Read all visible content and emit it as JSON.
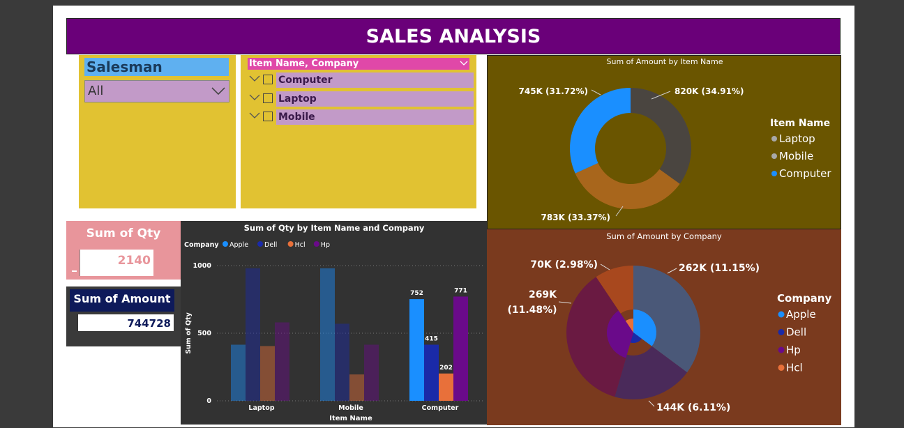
{
  "header": {
    "title": "SALES ANALYSIS"
  },
  "salesman_slicer": {
    "label": "Salesman",
    "value": "All"
  },
  "item_slicer": {
    "header": "Item Name, Company",
    "items": [
      {
        "label": "Computer"
      },
      {
        "label": "Laptop"
      },
      {
        "label": "Mobile"
      }
    ]
  },
  "cards": {
    "qty": {
      "title": "Sum of Qty",
      "value": "2140"
    },
    "amount": {
      "title": "Sum of Amount",
      "value": "744728"
    }
  },
  "colors": {
    "title_bg": "#6a0079",
    "slicer_bg": "#e1c232",
    "apple": "#1a8fff",
    "dell": "#1a2aa8",
    "hcl": "#e8703a",
    "hp": "#6a0a8a"
  },
  "chart_data": [
    {
      "type": "bar",
      "title": "Sum of Qty by Item Name and Company",
      "xlabel": "Item Name",
      "ylabel": "Sum of Qty",
      "legend_title": "Company",
      "legend_position": "top-left",
      "ylim": [
        0,
        1000
      ],
      "yticks": [
        0,
        500,
        1000
      ],
      "categories": [
        "Laptop",
        "Mobile",
        "Computer"
      ],
      "series": [
        {
          "name": "Apple",
          "color": "#1a8fff",
          "values": [
            415,
            980,
            752
          ],
          "labels": [
            "",
            "",
            "752"
          ]
        },
        {
          "name": "Dell",
          "color": "#1a2aa8",
          "values": [
            980,
            570,
            415
          ],
          "labels": [
            "",
            "",
            "415"
          ]
        },
        {
          "name": "Hcl",
          "color": "#e8703a",
          "values": [
            405,
            195,
            202
          ],
          "labels": [
            "",
            "",
            "202"
          ]
        },
        {
          "name": "Hp",
          "color": "#6a0a8a",
          "values": [
            580,
            415,
            771
          ],
          "labels": [
            "",
            "",
            "771"
          ]
        }
      ],
      "highlight_category": "Computer",
      "grid": true
    },
    {
      "type": "pie",
      "variant": "donut",
      "title": "Sum of Amount by Item Name",
      "legend_title": "Item Name",
      "legend_position": "right",
      "slices": [
        {
          "name": "Laptop",
          "value": 820,
          "label": "820K (34.91%)",
          "color": "#4a4540",
          "legend_color": "#a8a8a8"
        },
        {
          "name": "Mobile",
          "value": 783,
          "label": "783K (33.37%)",
          "color": "#a8661c",
          "legend_color": "#a8a8a8"
        },
        {
          "name": "Computer",
          "value": 745,
          "label": "745K (31.72%)",
          "color": "#1a8fff",
          "legend_color": "#1a8fff"
        }
      ]
    },
    {
      "type": "pie",
      "title": "Sum of Amount by Company",
      "legend_title": "Company",
      "legend_position": "right",
      "slices": [
        {
          "name": "Apple",
          "value": 262,
          "label": "262K (11.15%)",
          "color": "#4a5878",
          "inner_color": "#1a8fff"
        },
        {
          "name": "Dell",
          "value": 144,
          "label": "144K (6.11%)",
          "color": "#4a2a5a",
          "inner_color": "#1a2aa8"
        },
        {
          "name": "Hp",
          "value": 269,
          "label": "269K (11.48%)",
          "color": "#6a1a42",
          "inner_color": "#6a0a8a"
        },
        {
          "name": "Hcl",
          "value": 70,
          "label": "70K (2.98%)",
          "color": "#a8481e",
          "inner_color": "#e8703a"
        }
      ]
    }
  ]
}
